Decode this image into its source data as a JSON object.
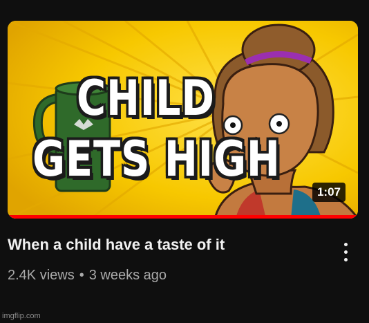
{
  "video": {
    "thumbnail_text_line1": "CHILD",
    "thumbnail_text_line2": "GETS HIGH",
    "duration": "1:07",
    "watch_progress": 1.0,
    "title": "When a child have a taste of it",
    "views": "2.4K views",
    "separator": "•",
    "age": "3 weeks ago"
  },
  "watermark": "imgflip.com",
  "colors": {
    "background": "#0f0f0f",
    "thumbnail_yellow": "#f5c400",
    "progress_red": "#ff0000",
    "title_text": "#f1f1f1",
    "meta_text": "#aaaaaa"
  }
}
